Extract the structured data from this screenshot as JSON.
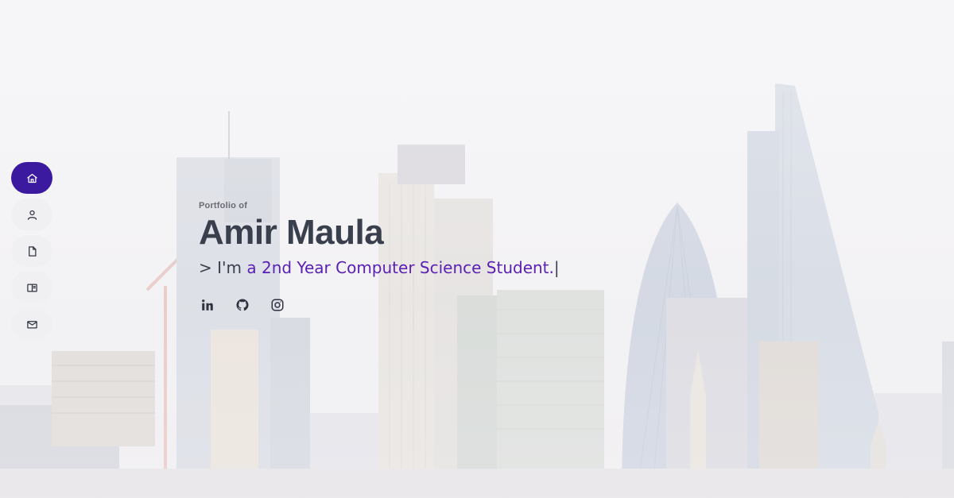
{
  "sidenav": {
    "items": [
      {
        "icon": "home-icon",
        "active": true
      },
      {
        "icon": "user-icon",
        "active": false
      },
      {
        "icon": "file-icon",
        "active": false
      },
      {
        "icon": "book-icon",
        "active": false
      },
      {
        "icon": "mail-icon",
        "active": false
      }
    ]
  },
  "hero": {
    "eyebrow": "Portfolio of",
    "name": "Amir Maula",
    "prompt": "> I'm",
    "typed": "a 2nd Year Computer Science Student.",
    "cursor": "|"
  },
  "socials": [
    {
      "icon": "linkedin-icon"
    },
    {
      "icon": "github-icon"
    },
    {
      "icon": "instagram-icon"
    }
  ],
  "colors": {
    "accent": "#3b1aa0",
    "typed_text": "#5a1fb3",
    "heading": "#3a3f4d"
  }
}
